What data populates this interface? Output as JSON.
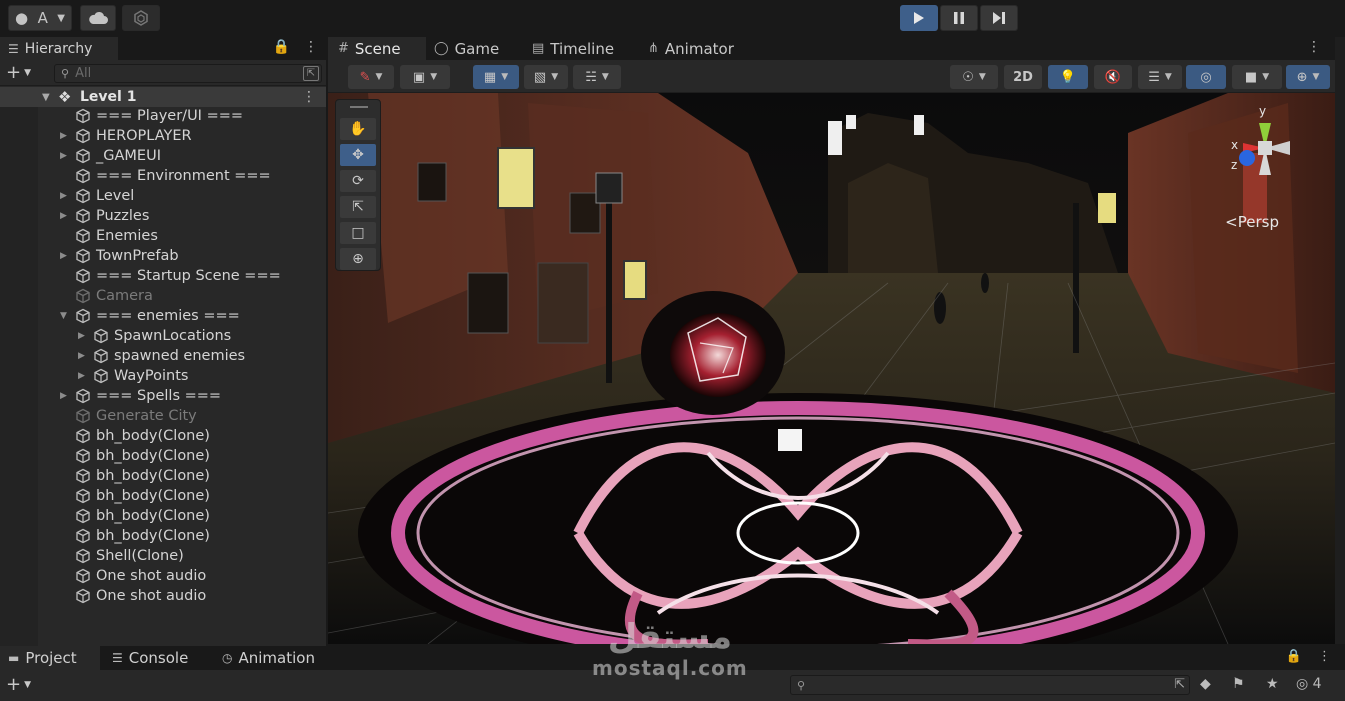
{
  "topbar": {
    "account_label": "A",
    "play_icon": "play-icon",
    "pause_icon": "pause-icon",
    "step_icon": "step-icon"
  },
  "hierarchy": {
    "tab_label": "Hierarchy",
    "search_placeholder": "All",
    "scene_name": "Level 1",
    "items": [
      {
        "label": "=== Player/UI ===",
        "depth": 1,
        "arrow": false,
        "dim": false
      },
      {
        "label": "HEROPLAYER",
        "depth": 1,
        "arrow": true,
        "dim": false
      },
      {
        "label": "_GAMEUI",
        "depth": 1,
        "arrow": true,
        "dim": false
      },
      {
        "label": "=== Environment ===",
        "depth": 1,
        "arrow": false,
        "dim": false
      },
      {
        "label": "Level",
        "depth": 1,
        "arrow": true,
        "dim": false
      },
      {
        "label": "Puzzles",
        "depth": 1,
        "arrow": true,
        "dim": false
      },
      {
        "label": "Enemies",
        "depth": 1,
        "arrow": false,
        "dim": false
      },
      {
        "label": "TownPrefab",
        "depth": 1,
        "arrow": true,
        "dim": false
      },
      {
        "label": "=== Startup Scene ===",
        "depth": 1,
        "arrow": false,
        "dim": false
      },
      {
        "label": "Camera",
        "depth": 1,
        "arrow": false,
        "dim": true
      },
      {
        "label": "=== enemies ===",
        "depth": 1,
        "arrow": true,
        "open": true,
        "dim": false
      },
      {
        "label": "SpawnLocations",
        "depth": 2,
        "arrow": true,
        "dim": false
      },
      {
        "label": "spawned enemies",
        "depth": 2,
        "arrow": true,
        "dim": false
      },
      {
        "label": "WayPoints",
        "depth": 2,
        "arrow": true,
        "dim": false
      },
      {
        "label": "=== Spells ===",
        "depth": 1,
        "arrow": true,
        "dim": false
      },
      {
        "label": "Generate City",
        "depth": 1,
        "arrow": false,
        "dim": true
      },
      {
        "label": "bh_body(Clone)",
        "depth": 1,
        "arrow": false,
        "dim": false
      },
      {
        "label": "bh_body(Clone)",
        "depth": 1,
        "arrow": false,
        "dim": false
      },
      {
        "label": "bh_body(Clone)",
        "depth": 1,
        "arrow": false,
        "dim": false
      },
      {
        "label": "bh_body(Clone)",
        "depth": 1,
        "arrow": false,
        "dim": false
      },
      {
        "label": "bh_body(Clone)",
        "depth": 1,
        "arrow": false,
        "dim": false
      },
      {
        "label": "bh_body(Clone)",
        "depth": 1,
        "arrow": false,
        "dim": false
      },
      {
        "label": "Shell(Clone)",
        "depth": 1,
        "arrow": false,
        "dim": false
      },
      {
        "label": "One shot audio",
        "depth": 1,
        "arrow": false,
        "dim": false
      },
      {
        "label": "One shot audio",
        "depth": 1,
        "arrow": false,
        "dim": false
      }
    ]
  },
  "scene_tabs": {
    "scene": "Scene",
    "game": "Game",
    "timeline": "Timeline",
    "animator": "Animator"
  },
  "scene_toolbar": {
    "two_d": "2D",
    "gizmo_persp": "Persp",
    "axis_x": "x",
    "axis_y": "y",
    "axis_z": "z"
  },
  "bottom_tabs": {
    "project": "Project",
    "console": "Console",
    "animation": "Animation"
  },
  "bottom_toolbar": {
    "hidden_count": "4"
  },
  "watermark": {
    "arabic": "مستقل",
    "latin": "mostaql.com"
  },
  "colors": {
    "accent_blue": "#3e5f8a",
    "panel_bg": "#282828",
    "magic_circle": "#e060b0"
  }
}
